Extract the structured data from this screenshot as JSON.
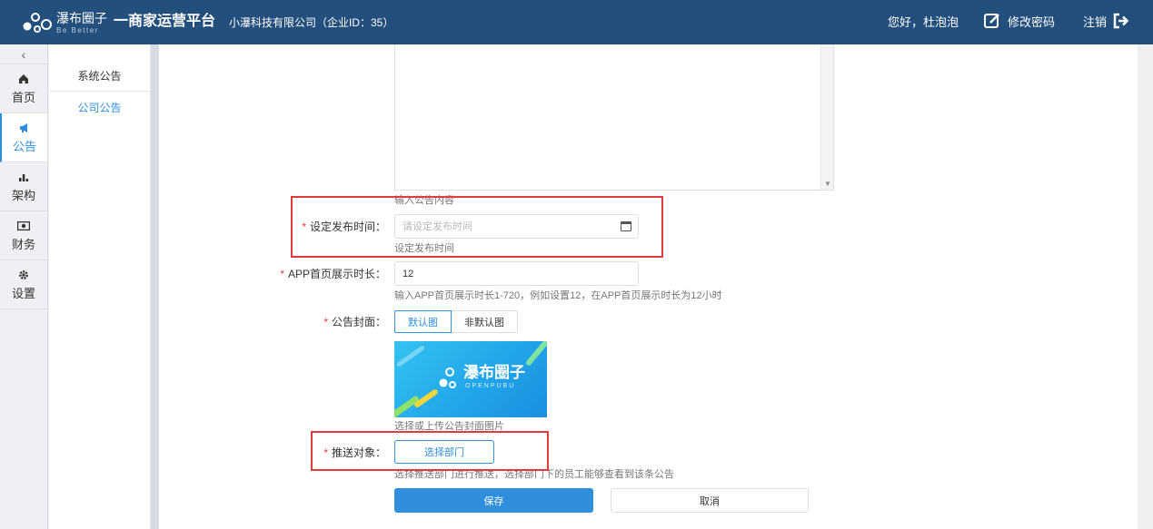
{
  "header": {
    "logo_text": "瀑布圈子",
    "logo_sub": "Be Better",
    "platform_title": "一商家运营平台",
    "company": "小瀑科技有限公司（企业ID：35）",
    "greeting": "您好，杜泡泡",
    "change_password": "修改密码",
    "logout": "注销"
  },
  "leftnav": {
    "collapse_icon": "chevron-left-icon",
    "items": [
      {
        "label": "首页",
        "icon": "home-icon"
      },
      {
        "label": "公告",
        "icon": "megaphone-icon",
        "active": true
      },
      {
        "label": "架构",
        "icon": "bar-chart-icon"
      },
      {
        "label": "财务",
        "icon": "money-icon"
      },
      {
        "label": "设置",
        "icon": "gear-icon"
      }
    ]
  },
  "subnav": {
    "items": [
      {
        "label": "系统公告"
      },
      {
        "label": "公司公告",
        "active": true
      }
    ]
  },
  "form": {
    "content_hint": "输入公告内容",
    "publish_time": {
      "label": "设定发布时间：",
      "placeholder": "请设定发布时间",
      "hint": "设定发布时间"
    },
    "display_duration": {
      "label": "APP首页展示时长：",
      "value": "12",
      "hint": "输入APP首页展示时长1-720，例如设置12，在APP首页展示时长为12小时"
    },
    "cover": {
      "label": "公告封面：",
      "options": [
        "默认图",
        "非默认图"
      ],
      "selected": "默认图",
      "image_brand": "瀑布圈子",
      "image_brand_sub": "OPENPUBU",
      "hint": "选择或上传公告封面图片"
    },
    "push_target": {
      "label": "推送对象：",
      "button": "选择部门",
      "hint": "选择推送部门进行推送，选择部门下的员工能够查看到该条公告"
    },
    "required_mark": "*",
    "save": "保存",
    "cancel": "取消"
  },
  "colors": {
    "header_bg": "#234f7d",
    "accent": "#2f8fdc",
    "highlight_border": "#e03c3c"
  }
}
